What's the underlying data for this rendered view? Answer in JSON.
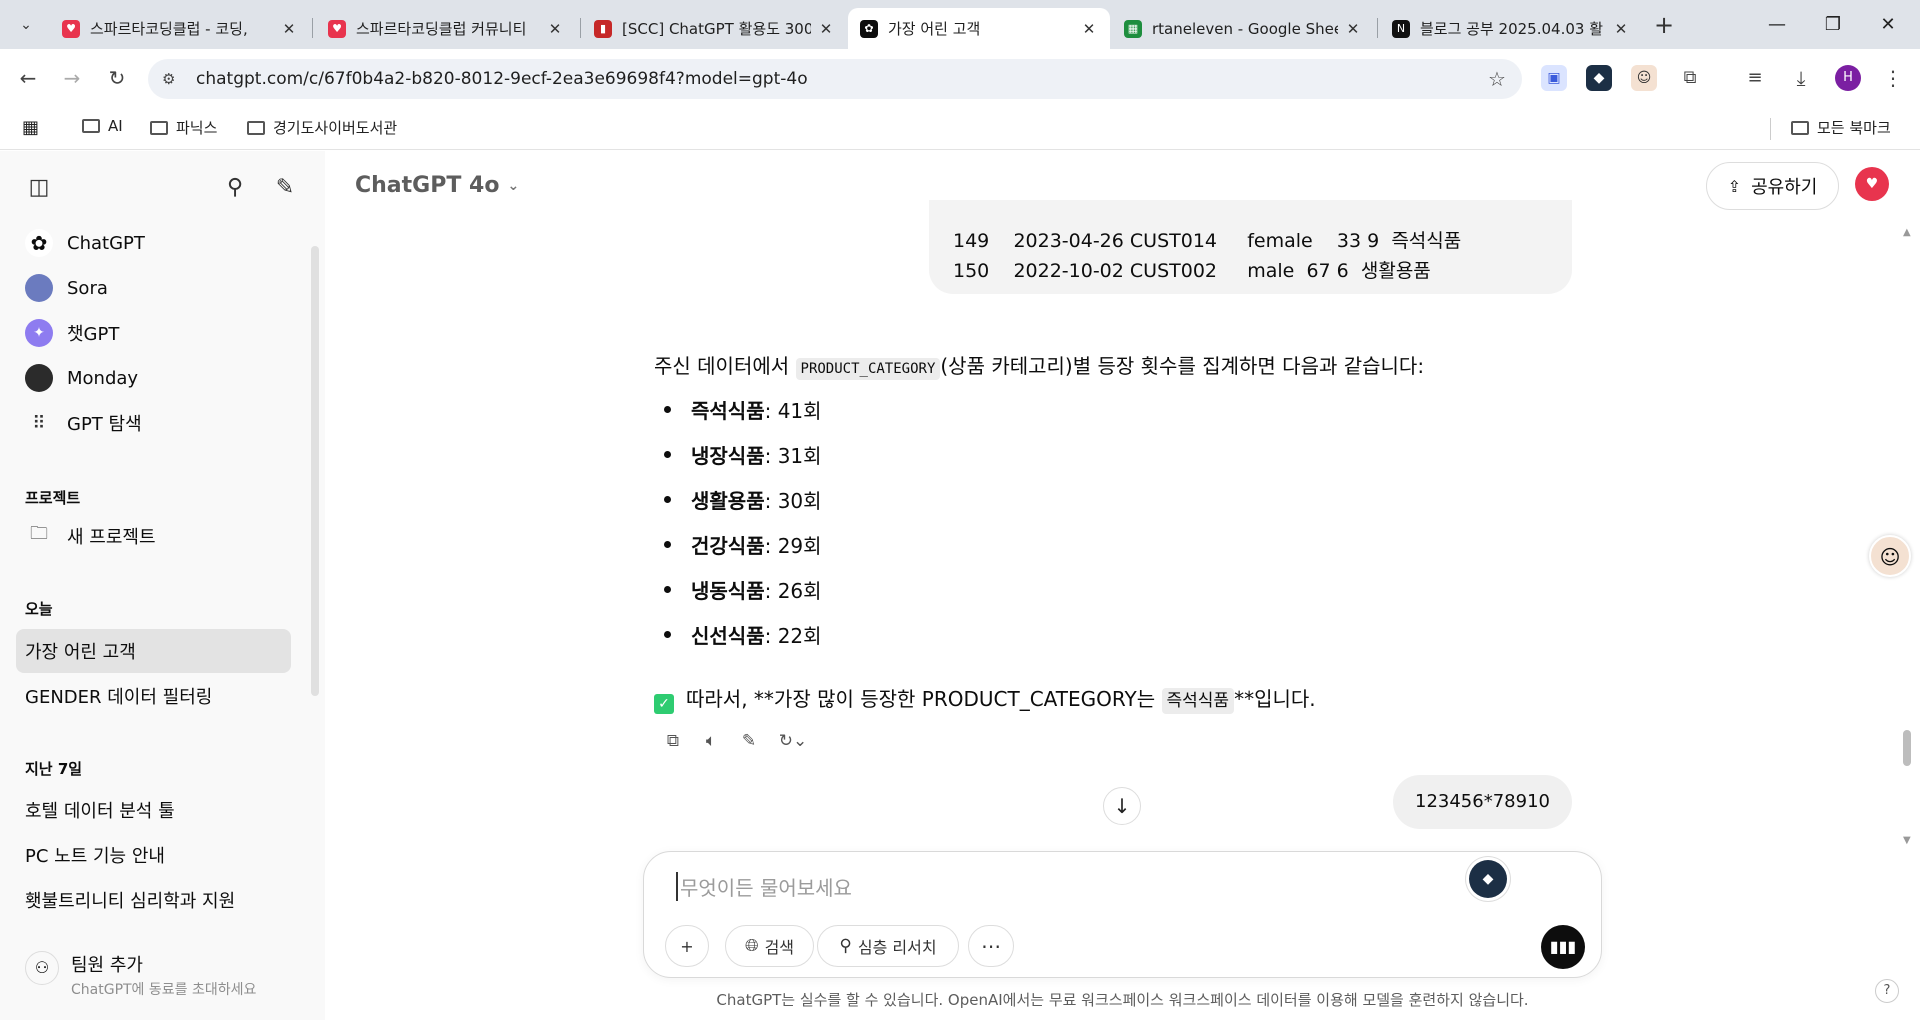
{
  "browser": {
    "tabs": [
      {
        "title": "스파르타코딩클럽 - 코딩,",
        "favicon": "heart-favicon",
        "color": "#e8344e"
      },
      {
        "title": "스파르타코딩클럽 커뮤니티",
        "favicon": "heart-favicon",
        "color": "#e8344e"
      },
      {
        "title": "[SCC] ChatGPT 활용도 300",
        "favicon": "book-favicon",
        "color": "#c62828"
      },
      {
        "title": "가장 어린 고객",
        "favicon": "openai-favicon",
        "color": "#0d0d0d"
      },
      {
        "title": "rtaneleven - Google Shee",
        "favicon": "sheets-favicon",
        "color": "#1e8e3e"
      },
      {
        "title": "블로그 공부 2025.04.03 활",
        "favicon": "notion-favicon",
        "color": "#111111"
      }
    ],
    "url": "chatgpt.com/c/67f0b4a2-b820-8012-9ecf-2ea3e69698f4?model=gpt-4o",
    "profile_initial": "H",
    "bookmarks": [
      "AI",
      "파닉스",
      "경기도사이버도서관"
    ],
    "all_bookmarks": "모든 북마크"
  },
  "sidebar": {
    "top_items": [
      {
        "label": "ChatGPT",
        "icon": "openai-icon"
      },
      {
        "label": "Sora",
        "icon": "sora-avatar"
      },
      {
        "label": "챗GPT",
        "icon": "chat-gpt-avatar"
      },
      {
        "label": "Monday",
        "icon": "monday-avatar"
      },
      {
        "label": "GPT 탐색",
        "icon": "grid-icon"
      }
    ],
    "projects_heading": "프로젝트",
    "new_project": "새 프로젝트",
    "today_heading": "오늘",
    "today_items": [
      "가장 어린 고객",
      "GENDER 데이터 필터링"
    ],
    "last7_heading": "지난 7일",
    "last7_items": [
      "호텔 데이터 분석 툴",
      "PC 노트 기능 안내",
      "횃불트리니티 심리학과 지원"
    ],
    "footer_title": "팀원 추가",
    "footer_sub": "ChatGPT에 동료를 초대하세요"
  },
  "header": {
    "model": "ChatGPT 4o",
    "share": "공유하기"
  },
  "conversation": {
    "table_rows": [
      {
        "idx": "149",
        "date": "2023-04-26",
        "cust": "CUST014",
        "gender": "female",
        "age": "33",
        "qty": "9",
        "category": "즉석식품"
      },
      {
        "idx": "150",
        "date": "2022-10-02",
        "cust": "CUST002",
        "gender": "male",
        "age": "67",
        "qty": "6",
        "category": "생활용품"
      }
    ],
    "intro_before": "주신 데이터에서 ",
    "intro_code": "PRODUCT_CATEGORY",
    "intro_after": "(상품 카테고리)별 등장 횟수를 집계하면 다음과 같습니다:",
    "counts": [
      {
        "name": "즉석식품",
        "value": ": 41회"
      },
      {
        "name": "냉장식품",
        "value": ": 31회"
      },
      {
        "name": "생활용품",
        "value": ": 30회"
      },
      {
        "name": "건강식품",
        "value": ": 29회"
      },
      {
        "name": "냉동식품",
        "value": ": 26회"
      },
      {
        "name": "신선식품",
        "value": ": 22회"
      }
    ],
    "conclusion_before": "따라서, **가장 많이 등장한 PRODUCT_CATEGORY는 ",
    "conclusion_code": "즉석식품",
    "conclusion_after": "**입니다.",
    "user_message": "123456*78910"
  },
  "composer": {
    "placeholder": "무엇이든 물어보세요",
    "search": "검색",
    "deep_research": "심층 리서치"
  },
  "disclaimer": "ChatGPT는 실수를 할 수 있습니다. OpenAI에서는 무료 워크스페이스 워크스페이스 데이터를 이용해 모델을 훈련하지 않습니다.",
  "help": "?"
}
